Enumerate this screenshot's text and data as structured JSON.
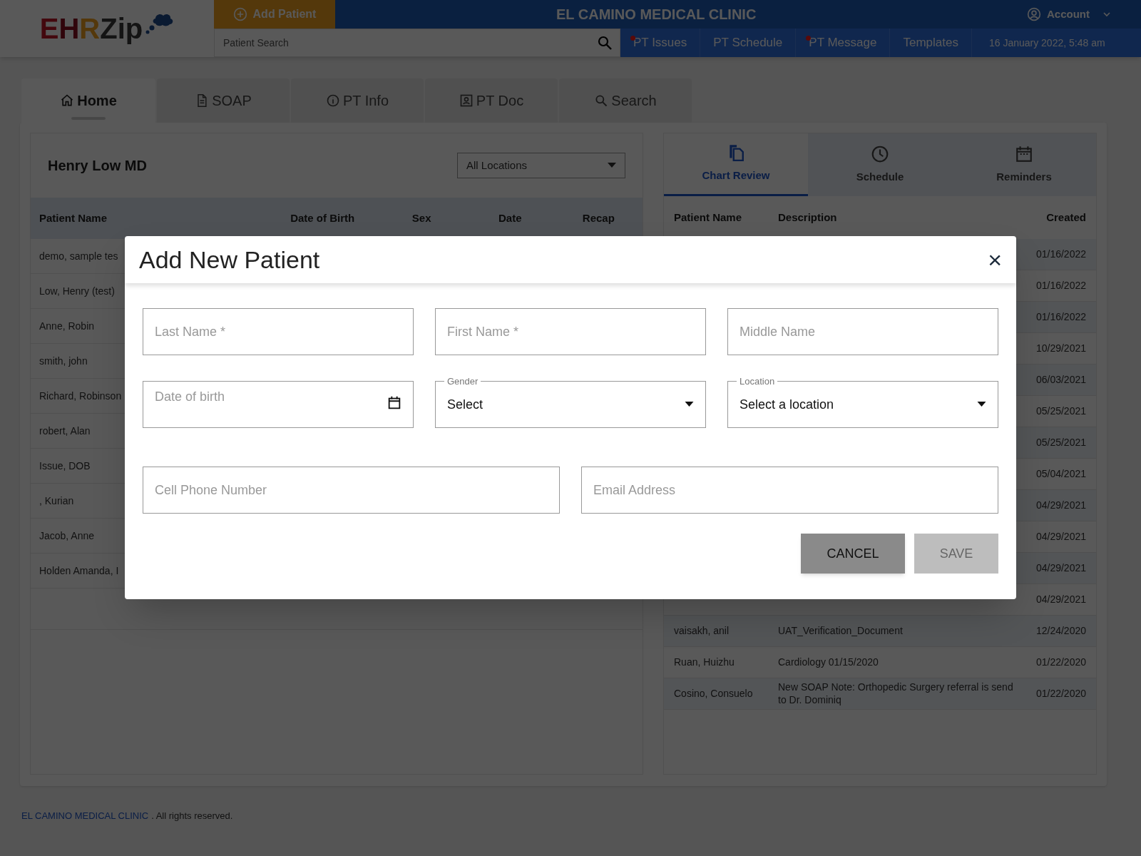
{
  "header": {
    "logo": [
      "E",
      "H",
      "R",
      "Zip"
    ],
    "add_patient": "Add Patient",
    "clinic": "EL CAMINO MEDICAL CLINIC",
    "account": "Account",
    "search": {
      "placeholder": "Patient Search"
    },
    "nav": [
      {
        "label": "PT Issues",
        "alert": true
      },
      {
        "label": "PT Schedule",
        "alert": false
      },
      {
        "label": "PT Message",
        "alert": true
      },
      {
        "label": "Templates",
        "alert": false
      }
    ],
    "datetime": "16 January 2022, 5:48 am"
  },
  "tabs": [
    {
      "label": "Home",
      "selected": true
    },
    {
      "label": "SOAP",
      "selected": false
    },
    {
      "label": "PT Info",
      "selected": false
    },
    {
      "label": "PT Doc",
      "selected": false
    },
    {
      "label": "Search",
      "selected": false
    }
  ],
  "left_panel": {
    "doctor": "Henry Low MD",
    "location_filter": "All Locations",
    "columns": [
      "Patient Name",
      "Date of Birth",
      "Sex",
      "Date",
      "Recap"
    ],
    "rows": [
      "demo, sample tes",
      "Low, Henry (test)",
      "Anne, Robin",
      "smith, john",
      "Richard, Robinson",
      "robert, Alan",
      "Issue, DOB",
      ", Kurian",
      "Jacob, Anne",
      "Holden Amanda, I"
    ]
  },
  "right_panel": {
    "tabs": [
      {
        "label": "Chart Review",
        "selected": true
      },
      {
        "label": "Schedule",
        "selected": false
      },
      {
        "label": "Reminders",
        "selected": false
      }
    ],
    "columns": [
      "Patient Name",
      "Description",
      "Created"
    ],
    "rows": [
      {
        "created": "01/16/2022"
      },
      {
        "created": "01/16/2022"
      },
      {
        "created": "01/16/2022"
      },
      {
        "created": "10/29/2021"
      },
      {
        "created": "06/03/2021"
      },
      {
        "created": "05/25/2021"
      },
      {
        "created": "05/25/2021"
      },
      {
        "created": "05/04/2021"
      },
      {
        "created": "04/29/2021"
      },
      {
        "created": "04/29/2021"
      },
      {
        "created": "04/29/2021"
      },
      {
        "created": "04/29/2021"
      },
      {
        "patient": "vaisakh, anil",
        "description": "UAT_Verification_Document",
        "created": "12/24/2020"
      },
      {
        "patient": "Ruan, Huizhu",
        "description": "Cardiology 01/15/2020",
        "created": "01/22/2020"
      },
      {
        "patient": "Cosino, Consuelo",
        "description": "New SOAP Note: Orthopedic Surgery referral is send to Dr. Dominiq",
        "created": "01/22/2020"
      }
    ]
  },
  "footer": {
    "link": "EL CAMINO MEDICAL CLINIC",
    "text": ". All rights reserved."
  },
  "dialog": {
    "title": "Add New Patient",
    "close": "×",
    "rows": [
      [
        {
          "kind": "text",
          "placeholder": "Last Name *"
        },
        {
          "kind": "text",
          "placeholder": "First Name *"
        },
        {
          "kind": "text",
          "placeholder": "Middle Name"
        }
      ],
      [
        {
          "kind": "date",
          "placeholder": "Date of birth"
        },
        {
          "kind": "select",
          "label": "Gender",
          "value": "Select"
        },
        {
          "kind": "select",
          "label": "Location",
          "value": "Select a location"
        }
      ],
      [
        {
          "kind": "text",
          "placeholder": "Cell Phone Number"
        },
        {
          "kind": "text",
          "placeholder": "Email Address"
        }
      ]
    ],
    "buttons": [
      {
        "label": "CANCEL",
        "disabled": false
      },
      {
        "label": "SAVE",
        "disabled": true
      }
    ]
  }
}
